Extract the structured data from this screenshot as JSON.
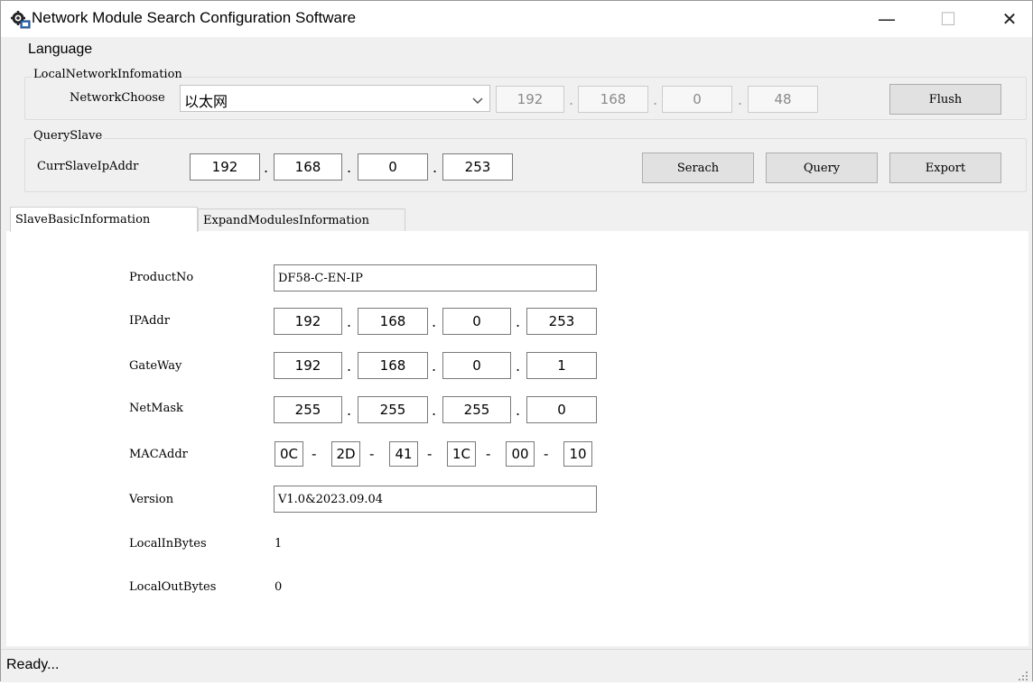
{
  "window": {
    "title": "Network Module Search Configuration Software",
    "minimize": "—",
    "maximize": "☐",
    "close": "✕"
  },
  "menu": {
    "language": "Language"
  },
  "local_network": {
    "group_title": "LocalNetworkInfomation",
    "network_choose_label": "NetworkChoose",
    "network_choose_value": "以太网",
    "ip": [
      "192",
      "168",
      "0",
      "48"
    ],
    "flush_label": "Flush"
  },
  "query_slave": {
    "group_title": "QuerySlave",
    "curr_slave_label": "CurrSlaveIpAddr",
    "ip": [
      "192",
      "168",
      "0",
      "253"
    ],
    "search_label": "Serach",
    "query_label": "Query",
    "export_label": "Export"
  },
  "tabs": [
    "SlaveBasicInformation",
    "ExpandModulesInformation"
  ],
  "slave_info": {
    "product_no_label": "ProductNo",
    "product_no": "DF58-C-EN-IP",
    "ipaddr_label": "IPAddr",
    "ipaddr": [
      "192",
      "168",
      "0",
      "253"
    ],
    "gateway_label": "GateWay",
    "gateway": [
      "192",
      "168",
      "0",
      "1"
    ],
    "netmask_label": "NetMask",
    "netmask": [
      "255",
      "255",
      "255",
      "0"
    ],
    "mac_label": "MACAddr",
    "mac": [
      "0C",
      "2D",
      "41",
      "1C",
      "00",
      "10"
    ],
    "version_label": "Version",
    "version": "V1.0&2023.09.04",
    "local_in_label": "LocalInBytes",
    "local_in": "1",
    "local_out_label": "LocalOutBytes",
    "local_out": "0"
  },
  "status": {
    "text": "Ready..."
  },
  "separators": {
    "dot": ".",
    "dash": "-"
  }
}
